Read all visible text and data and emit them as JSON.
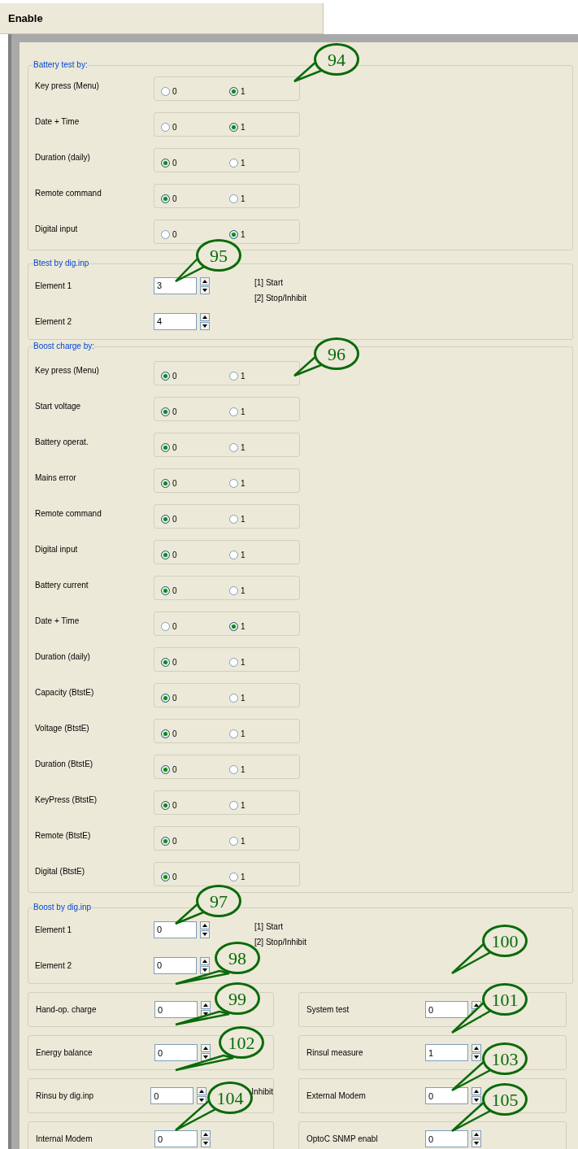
{
  "header": {
    "title": "Enable"
  },
  "groups": [
    {
      "kind": "radio",
      "title": "Battery test by:",
      "rows": [
        {
          "label": "Key press (Menu)",
          "options": [
            {
              "text": "0",
              "selected": false
            },
            {
              "text": "1",
              "selected": true
            }
          ]
        },
        {
          "label": "Date + Time",
          "options": [
            {
              "text": "0",
              "selected": false
            },
            {
              "text": "1",
              "selected": true
            }
          ]
        },
        {
          "label": "Duration (daily)",
          "options": [
            {
              "text": "0",
              "selected": true
            },
            {
              "text": "1",
              "selected": false
            }
          ]
        },
        {
          "label": "Remote command",
          "options": [
            {
              "text": "0",
              "selected": true
            },
            {
              "text": "1",
              "selected": false
            }
          ]
        },
        {
          "label": "Digital input",
          "options": [
            {
              "text": "0",
              "selected": false
            },
            {
              "text": "1",
              "selected": true
            }
          ]
        }
      ]
    },
    {
      "kind": "spin",
      "title": "Btest by dig.inp",
      "notes": [
        "[1] Start",
        "[2] Stop/Inhibit"
      ],
      "rows": [
        {
          "label": "Element 1",
          "value": "3"
        },
        {
          "label": "Element 2",
          "value": "4"
        }
      ]
    },
    {
      "kind": "radio",
      "title": "Boost charge by:",
      "rows": [
        {
          "label": "Key press (Menu)",
          "options": [
            {
              "text": "0",
              "selected": true
            },
            {
              "text": "1",
              "selected": false
            }
          ]
        },
        {
          "label": "Start voltage",
          "options": [
            {
              "text": "0",
              "selected": true
            },
            {
              "text": "1",
              "selected": false
            }
          ]
        },
        {
          "label": "Battery operat.",
          "options": [
            {
              "text": "0",
              "selected": true
            },
            {
              "text": "1",
              "selected": false
            }
          ]
        },
        {
          "label": "Mains error",
          "options": [
            {
              "text": "0",
              "selected": true
            },
            {
              "text": "1",
              "selected": false
            }
          ]
        },
        {
          "label": "Remote command",
          "options": [
            {
              "text": "0",
              "selected": true
            },
            {
              "text": "1",
              "selected": false
            }
          ]
        },
        {
          "label": "Digital input",
          "options": [
            {
              "text": "0",
              "selected": true
            },
            {
              "text": "1",
              "selected": false
            }
          ]
        },
        {
          "label": "Battery current",
          "options": [
            {
              "text": "0",
              "selected": true
            },
            {
              "text": "1",
              "selected": false
            }
          ]
        },
        {
          "label": "Date + Time",
          "options": [
            {
              "text": "0",
              "selected": false
            },
            {
              "text": "1",
              "selected": true
            }
          ]
        },
        {
          "label": "Duration (daily)",
          "options": [
            {
              "text": "0",
              "selected": true
            },
            {
              "text": "1",
              "selected": false
            }
          ]
        },
        {
          "label": "Capacity (BtstE)",
          "options": [
            {
              "text": "0",
              "selected": true
            },
            {
              "text": "1",
              "selected": false
            }
          ]
        },
        {
          "label": "Voltage (BtstE)",
          "options": [
            {
              "text": "0",
              "selected": true
            },
            {
              "text": "1",
              "selected": false
            }
          ]
        },
        {
          "label": "Duration (BtstE)",
          "options": [
            {
              "text": "0",
              "selected": true
            },
            {
              "text": "1",
              "selected": false
            }
          ]
        },
        {
          "label": "KeyPress (BtstE)",
          "options": [
            {
              "text": "0",
              "selected": true
            },
            {
              "text": "1",
              "selected": false
            }
          ]
        },
        {
          "label": "Remote (BtstE)",
          "options": [
            {
              "text": "0",
              "selected": true
            },
            {
              "text": "1",
              "selected": false
            }
          ]
        },
        {
          "label": "Digital (BtstE)",
          "options": [
            {
              "text": "0",
              "selected": true
            },
            {
              "text": "1",
              "selected": false
            }
          ]
        }
      ]
    },
    {
      "kind": "spin",
      "title": "Boost by dig.inp",
      "notes": [
        "[1] Start",
        "[2] Stop/Inhibit"
      ],
      "rows": [
        {
          "label": "Element 1",
          "value": "0"
        },
        {
          "label": "Element 2",
          "value": "0"
        }
      ]
    }
  ],
  "pairs": [
    {
      "left": {
        "label": "Hand-op. charge",
        "value": "0"
      },
      "right": {
        "label": "System test",
        "value": "0"
      }
    },
    {
      "left": {
        "label": "Energy balance",
        "value": "0"
      },
      "right": {
        "label": "Rinsul measure",
        "value": "1"
      }
    },
    {
      "left": {
        "label": "Rinsu by dig.inp",
        "value": "0",
        "note": "Inhibit"
      },
      "right": {
        "label": "External Modem",
        "value": "0"
      }
    },
    {
      "left": {
        "label": "Internal Modem",
        "value": "0"
      },
      "right": {
        "label": "OptoC SNMP enabl",
        "value": "0"
      }
    }
  ],
  "callouts": [
    {
      "number": "94"
    },
    {
      "number": "95"
    },
    {
      "number": "96"
    },
    {
      "number": "97"
    },
    {
      "number": "98"
    },
    {
      "number": "99"
    },
    {
      "number": "100"
    },
    {
      "number": "101"
    },
    {
      "number": "102"
    },
    {
      "number": "103"
    },
    {
      "number": "104"
    },
    {
      "number": "105"
    }
  ]
}
